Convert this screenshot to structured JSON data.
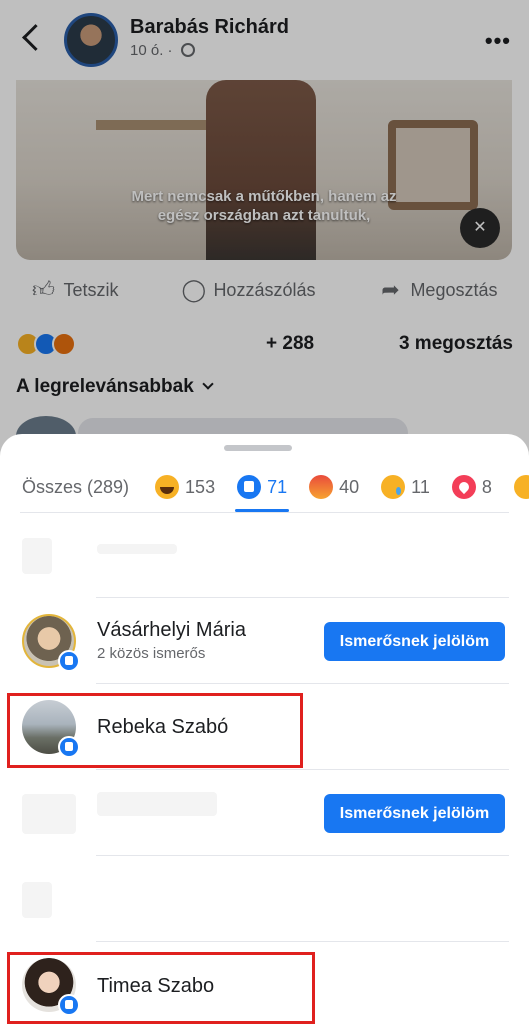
{
  "post": {
    "author": "Barabás Richárd",
    "time": "10 ó. ·",
    "more": "•••",
    "subtitle_line1": "Mert nemcsak a műtőkben, hanem az",
    "subtitle_line2": "egész országban azt tanultuk,",
    "actions": {
      "like": "Tetszik",
      "comment": "Hozzászólás",
      "share": "Megosztás"
    },
    "reaction_count": "+ 288",
    "share_count": "3 megosztás",
    "sort_label": "A legrelevánsabbak"
  },
  "reactions_sheet": {
    "tabs": [
      {
        "label": "Összes (289)",
        "icon": "all"
      },
      {
        "label": "153",
        "icon": "haha-emoji"
      },
      {
        "label": "71",
        "icon": "like-emoji",
        "active": true
      },
      {
        "label": "40",
        "icon": "angry-emoji"
      },
      {
        "label": "11",
        "icon": "sad-emoji"
      },
      {
        "label": "8",
        "icon": "love-emoji"
      }
    ],
    "people": [
      {
        "name": "Vásárhelyi Mária",
        "mutual": "2 közös ismerős",
        "button": "Ismerősnek jelölöm"
      },
      {
        "name": "Rebeka Szabó"
      },
      {
        "button": "Ismerősnek jelölöm"
      },
      {
        "name": "Timea Szabo"
      }
    ]
  },
  "colors": {
    "accent": "#1877f2",
    "highlight": "#e0201e"
  }
}
